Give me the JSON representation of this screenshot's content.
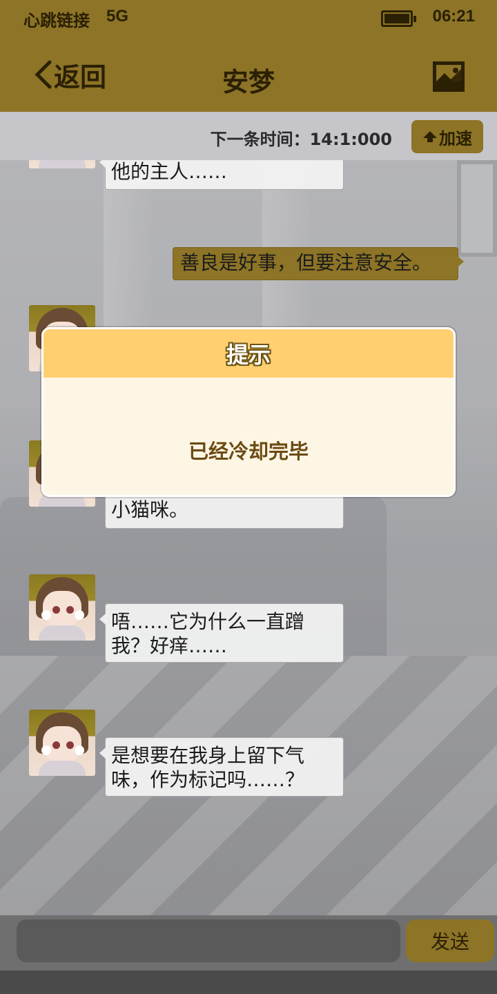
{
  "status_bar": {
    "carrier": "心跳链接",
    "network": "5G",
    "time": "06:21",
    "battery_icon": "battery-full-icon"
  },
  "header": {
    "back_label": "返回",
    "back_icon": "chevron-left-icon",
    "title": "安梦",
    "image_icon": "image-icon"
  },
  "subbar": {
    "next_time": "下一条时间：14:1:000",
    "speed_label": "加速",
    "speed_icon": "arrow-up-icon"
  },
  "messages": [
    {
      "side": "left",
      "avatar": true,
      "text_lines": [
        "他的主人……"
      ]
    },
    {
      "side": "right",
      "text_lines": [
        "善良是好事，但要注意安全。"
      ]
    },
    {
      "side": "left",
      "avatar": true,
      "text_lines": []
    },
    {
      "side": "left",
      "avatar": true,
      "text_lines": [
        "小猫咪。"
      ]
    },
    {
      "side": "left",
      "avatar": true,
      "text_lines": [
        "唔……它为什么一直蹭",
        "我？好痒……"
      ]
    },
    {
      "side": "left",
      "avatar": true,
      "text_lines": [
        "是想要在我身上留下气",
        "味，作为标记吗……？"
      ]
    }
  ],
  "input": {
    "placeholder": "",
    "send_label": "发送"
  },
  "dialog": {
    "title": "提示",
    "message": "已经冷却完毕"
  },
  "colors": {
    "header": "#8d7426",
    "dialog_header": "#ffcf70",
    "dialog_body": "#fdf6e5",
    "dialog_text": "#6b4a12"
  }
}
